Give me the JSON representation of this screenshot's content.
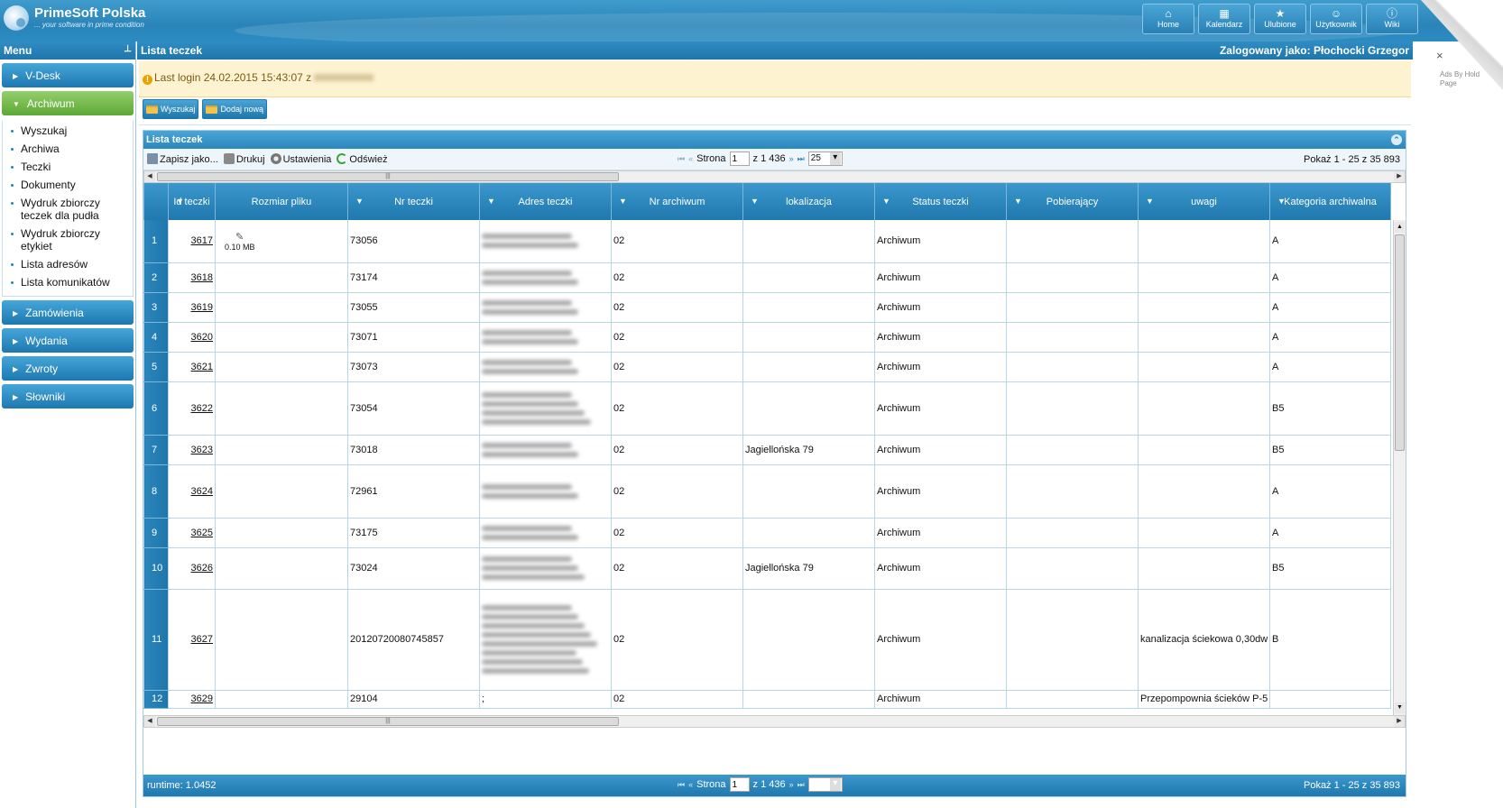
{
  "brand": {
    "title": "PrimeSoft Polska",
    "tagline": "... your software in prime condition"
  },
  "topnav": [
    {
      "label": "Home",
      "icon": "home-icon",
      "glyph": "⌂"
    },
    {
      "label": "Kalendarz",
      "icon": "calendar-icon",
      "glyph": "▦"
    },
    {
      "label": "Ulubione",
      "icon": "star-icon",
      "glyph": "★"
    },
    {
      "label": "Użytkownik",
      "icon": "user-icon",
      "glyph": "☺"
    },
    {
      "label": "Wiki",
      "icon": "info-icon",
      "glyph": "ⓘ"
    }
  ],
  "ad": {
    "close": "×",
    "text": "Ads By Hold Page"
  },
  "sidebar": {
    "title": "Menu",
    "sections": [
      {
        "label": "V-Desk"
      },
      {
        "label": "Archiwum",
        "open": true,
        "items": [
          "Wyszukaj",
          "Archiwa",
          "Teczki",
          "Dokumenty",
          "Wydruk zbiorczy teczek dla pudła",
          "Wydruk zbiorczy etykiet",
          "Lista adresów",
          "Lista komunikatów"
        ]
      },
      {
        "label": "Zamówienia"
      },
      {
        "label": "Wydania"
      },
      {
        "label": "Zwroty"
      },
      {
        "label": "Słowniki"
      }
    ]
  },
  "main": {
    "title": "Lista teczek",
    "logged_in": "Zalogowany jako: Płochocki Grzegor",
    "last_login": "Last login 24.02.2015 15:43:07 z",
    "buttons": {
      "search": "Wyszukaj",
      "add": "Dodaj nową"
    }
  },
  "panel": {
    "title": "Lista teczek",
    "toolbar": {
      "save": "Zapisz jako...",
      "print": "Drukuj",
      "settings": "Ustawienia",
      "refresh": "Odśwież"
    },
    "pager": {
      "page_label": "Strona",
      "page": "1",
      "of": "z 1 436",
      "per_page": "25",
      "summary": "Pokaż 1 - 25 z 35 893"
    },
    "runtime": "runtime: 1.0452"
  },
  "table": {
    "headers": [
      "Id teczki",
      "Rozmiar pliku",
      "Nr teczki",
      "Adres teczki",
      "Nr archiwum",
      "lokalizacja",
      "Status teczki",
      "Pobierający",
      "uwagi",
      "Kategoria archiwalna"
    ],
    "rows": [
      {
        "n": "1",
        "id": "3617",
        "size": "0.10 MB",
        "nr": "73056",
        "arch": "02",
        "lok": "",
        "status": "Archiwum",
        "pob": "",
        "uwagi": "",
        "kat": "A",
        "h": 47,
        "bl": 2
      },
      {
        "n": "2",
        "id": "3618",
        "size": "",
        "nr": "73174",
        "arch": "02",
        "lok": "",
        "status": "Archiwum",
        "pob": "",
        "uwagi": "",
        "kat": "A",
        "h": 33,
        "bl": 2
      },
      {
        "n": "3",
        "id": "3619",
        "size": "",
        "nr": "73055",
        "arch": "02",
        "lok": "",
        "status": "Archiwum",
        "pob": "",
        "uwagi": "",
        "kat": "A",
        "h": 33,
        "bl": 2
      },
      {
        "n": "4",
        "id": "3620",
        "size": "",
        "nr": "73071",
        "arch": "02",
        "lok": "",
        "status": "Archiwum",
        "pob": "",
        "uwagi": "",
        "kat": "A",
        "h": 33,
        "bl": 2
      },
      {
        "n": "5",
        "id": "3621",
        "size": "",
        "nr": "73073",
        "arch": "02",
        "lok": "",
        "status": "Archiwum",
        "pob": "",
        "uwagi": "",
        "kat": "A",
        "h": 33,
        "bl": 2
      },
      {
        "n": "6",
        "id": "3622",
        "size": "",
        "nr": "73054",
        "arch": "02",
        "lok": "",
        "status": "Archiwum",
        "pob": "",
        "uwagi": "",
        "kat": "B5",
        "h": 59,
        "bl": 4
      },
      {
        "n": "7",
        "id": "3623",
        "size": "",
        "nr": "73018",
        "arch": "02",
        "lok": "Jagiellońska 79",
        "status": "Archiwum",
        "pob": "",
        "uwagi": "",
        "kat": "B5",
        "h": 33,
        "bl": 2
      },
      {
        "n": "8",
        "id": "3624",
        "size": "",
        "nr": "72961",
        "arch": "02",
        "lok": "",
        "status": "Archiwum",
        "pob": "",
        "uwagi": "",
        "kat": "A",
        "h": 59,
        "bl": 2
      },
      {
        "n": "9",
        "id": "3625",
        "size": "",
        "nr": "73175",
        "arch": "02",
        "lok": "",
        "status": "Archiwum",
        "pob": "",
        "uwagi": "",
        "kat": "A",
        "h": 33,
        "bl": 2
      },
      {
        "n": "10",
        "id": "3626",
        "size": "",
        "nr": "73024",
        "arch": "02",
        "lok": "Jagiellońska 79",
        "status": "Archiwum",
        "pob": "",
        "uwagi": "",
        "kat": "B5",
        "h": 46,
        "bl": 3
      },
      {
        "n": "11",
        "id": "3627",
        "size": "",
        "nr": "20120720080745857",
        "arch": "02",
        "lok": "",
        "status": "Archiwum",
        "pob": "",
        "uwagi": "kanalizacja ściekowa 0,30dw",
        "kat": "B",
        "h": 112,
        "bl": 8
      },
      {
        "n": "12",
        "id": "3629",
        "size": "",
        "nr": "29104",
        "addr": ";",
        "arch": "02",
        "lok": "",
        "status": "Archiwum",
        "pob": "",
        "uwagi": "Przepompownia ścieków P-5",
        "kat": "",
        "h": 20,
        "bl": 0
      }
    ]
  }
}
